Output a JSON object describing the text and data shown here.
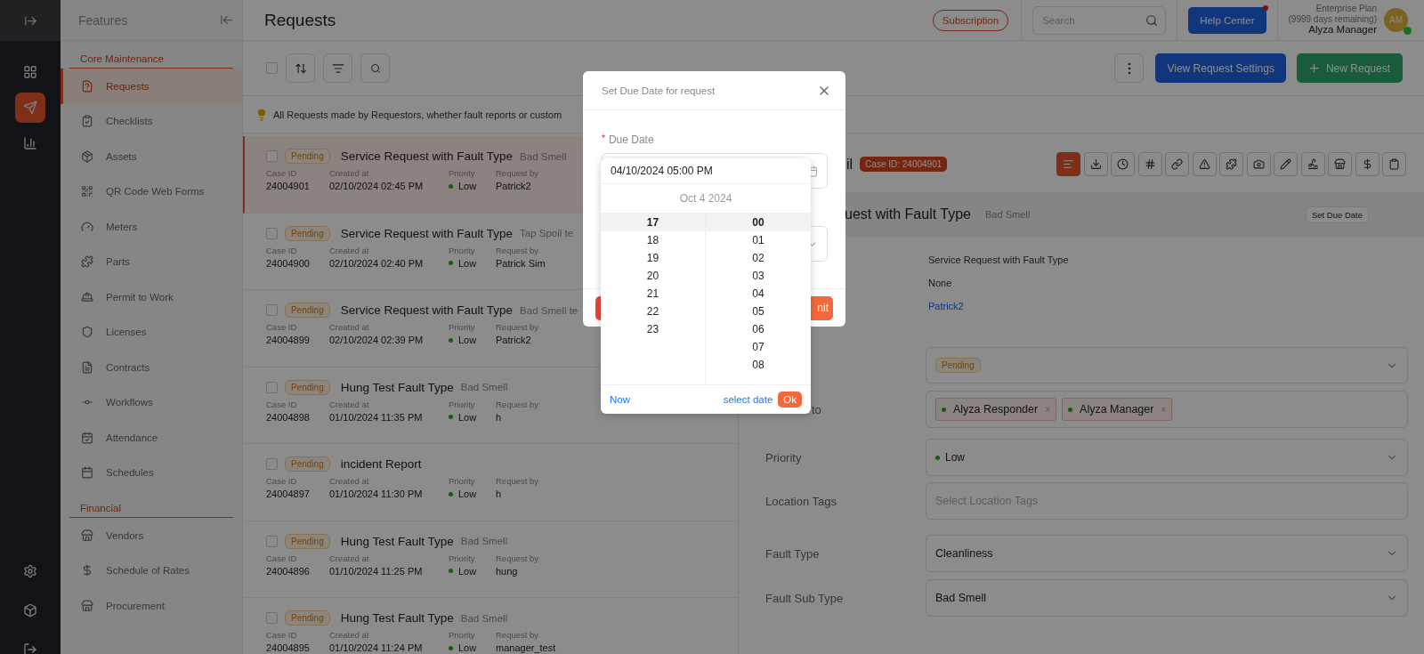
{
  "rail": {
    "items": [
      {
        "selected": false
      },
      {
        "selected": true
      },
      {
        "selected": false
      }
    ]
  },
  "sidebar": {
    "title": "Features",
    "sections": [
      {
        "title": "Core Maintenance",
        "items": [
          {
            "label": "Requests",
            "selected": true
          },
          {
            "label": "Checklists",
            "selected": false
          },
          {
            "label": "Assets",
            "selected": false
          },
          {
            "label": "QR Code Web Forms",
            "selected": false
          },
          {
            "label": "Meters",
            "selected": false
          },
          {
            "label": "Parts",
            "selected": false
          },
          {
            "label": "Permit to Work",
            "selected": false
          },
          {
            "label": "Licenses",
            "selected": false
          },
          {
            "label": "Contracts",
            "selected": false
          },
          {
            "label": "Workflows",
            "selected": false
          },
          {
            "label": "Attendance",
            "selected": false
          },
          {
            "label": "Schedules",
            "selected": false
          }
        ]
      },
      {
        "title": "Financial",
        "items": [
          {
            "label": "Vendors",
            "selected": false
          },
          {
            "label": "Schedule of Rates",
            "selected": false
          },
          {
            "label": "Procurement",
            "selected": false
          }
        ]
      }
    ]
  },
  "header": {
    "title": "Requests",
    "subscription": "Subscription",
    "search": {
      "placeholder": "Search"
    },
    "help": "Help Center",
    "plan": "Enterprise Plan",
    "days": "(9999 days remaining)",
    "user": "Alyza Manager",
    "avatar": "AM"
  },
  "toolbar": {
    "select_all_checked": false,
    "settings_button": "View Request Settings",
    "new_button": "New Request"
  },
  "info": "All Requests made by Requestors, whether fault reports or custom",
  "requests": [
    {
      "checked": false,
      "title": "Service Request with Fault Type",
      "subtitle": "Bad Smell",
      "status": "Pending",
      "case_label": "Case ID",
      "case_id": "24004901",
      "created_label": "Created at",
      "created": "02/10/2024 02:45 PM",
      "priority_label": "Priority",
      "priority": "Low",
      "by_label": "Request by",
      "by": "Patrick2",
      "selected": true
    },
    {
      "checked": false,
      "title": "Service Request with Fault Type",
      "subtitle": "Tap Spoil te",
      "status": "Pending",
      "case_label": "Case ID",
      "case_id": "24004900",
      "created_label": "Created at",
      "created": "02/10/2024 02:40 PM",
      "priority_label": "Priority",
      "priority": "Low",
      "by_label": "Request by",
      "by": "Patrick Sim",
      "selected": false
    },
    {
      "checked": false,
      "title": "Service Request with Fault Type",
      "subtitle": "Bad Smell te",
      "status": "Pending",
      "case_label": "Case ID",
      "case_id": "24004899",
      "created_label": "Created at",
      "created": "02/10/2024 02:39 PM",
      "priority_label": "Priority",
      "priority": "Low",
      "by_label": "Request by",
      "by": "Patrick2",
      "selected": false
    },
    {
      "checked": false,
      "title": "Hung Test Fault Type",
      "subtitle": "Bad Smell",
      "status": "Pending",
      "case_label": "Case ID",
      "case_id": "24004898",
      "created_label": "Created at",
      "created": "01/10/2024 11:35 PM",
      "priority_label": "Priority",
      "priority": "Low",
      "by_label": "Request by",
      "by": "h",
      "selected": false
    },
    {
      "checked": false,
      "title": "incident Report",
      "status": "Pending",
      "case_label": "Case ID",
      "case_id": "24004897",
      "created_label": "Created at",
      "created": "01/10/2024 11:30 PM",
      "priority_label": "Priority",
      "priority": "Low",
      "by_label": "Request by",
      "by": "h",
      "selected": false
    },
    {
      "checked": false,
      "title": "Hung Test Fault Type",
      "subtitle": "Bad Smell",
      "status": "Pending",
      "case_label": "Case ID",
      "case_id": "24004896",
      "created_label": "Created at",
      "created": "01/10/2024 11:25 PM",
      "priority_label": "Priority",
      "priority": "Low",
      "by_label": "Request by",
      "by": "hung",
      "selected": false
    },
    {
      "checked": false,
      "title": "Hung Test Fault Type",
      "subtitle": "Bad Smell",
      "status": "Pending",
      "case_label": "Case ID",
      "case_id": "24004895",
      "created_label": "Created at",
      "created": "01/10/2024 11:24 PM",
      "priority_label": "Priority",
      "priority": "Low",
      "by_label": "Request by",
      "by": "manager_test",
      "selected": false
    }
  ],
  "detail": {
    "title": "il",
    "case_badge": "Case ID: 24004901",
    "tools": [
      {
        "selected": true
      },
      {
        "selected": false
      },
      {
        "selected": false
      },
      {
        "selected": false
      },
      {
        "selected": false
      },
      {
        "selected": false
      },
      {
        "selected": false
      },
      {
        "selected": false
      },
      {
        "selected": false
      },
      {
        "selected": false
      },
      {
        "selected": false
      },
      {
        "selected": false
      },
      {
        "selected": false
      }
    ],
    "heading": "uest with Fault Type",
    "heading_sub": "Bad Smell",
    "due_button": "Set Due Date",
    "values": [
      {
        "kind": "text",
        "text": "Service Request with Fault Type"
      },
      {
        "kind": "text",
        "text": "None"
      },
      {
        "kind": "link",
        "text": "Patrick2"
      }
    ],
    "fields": [
      {
        "kind": "status",
        "value": "Pending"
      },
      {
        "kind": "tags",
        "label": "to",
        "tags": [
          {
            "name": "Alyza Responder",
            "remove": "×"
          },
          {
            "name": "Alyza Manager",
            "remove": "×"
          }
        ]
      },
      {
        "kind": "priority",
        "label": "Priority",
        "value": "Low"
      },
      {
        "kind": "empty",
        "label": "Location Tags",
        "placeholder": "Select Location Tags"
      },
      {
        "kind": "select",
        "label": "Fault Type",
        "value": "Cleanliness"
      },
      {
        "kind": "select",
        "label": "Fault Sub Type",
        "value": "Bad Smell"
      }
    ]
  },
  "modal": {
    "title": "Set Due Date for request",
    "required_mark": "*",
    "label": "Due Date",
    "submit": "nit"
  },
  "picker": {
    "value": "04/10/2024 05:00 PM",
    "date": "Oct 4 2024",
    "hours": [
      {
        "text": "17",
        "selected": true
      },
      {
        "text": "18",
        "selected": false
      },
      {
        "text": "19",
        "selected": false
      },
      {
        "text": "20",
        "selected": false
      },
      {
        "text": "21",
        "selected": false
      },
      {
        "text": "22",
        "selected": false
      },
      {
        "text": "23",
        "selected": false
      }
    ],
    "minutes": [
      {
        "text": "00",
        "selected": true
      },
      {
        "text": "01",
        "selected": false
      },
      {
        "text": "02",
        "selected": false
      },
      {
        "text": "03",
        "selected": false
      },
      {
        "text": "04",
        "selected": false
      },
      {
        "text": "05",
        "selected": false
      },
      {
        "text": "06",
        "selected": false
      },
      {
        "text": "07",
        "selected": false
      },
      {
        "text": "08",
        "selected": false
      }
    ],
    "now": "Now",
    "select_date": "select date",
    "ok": "Ok"
  }
}
